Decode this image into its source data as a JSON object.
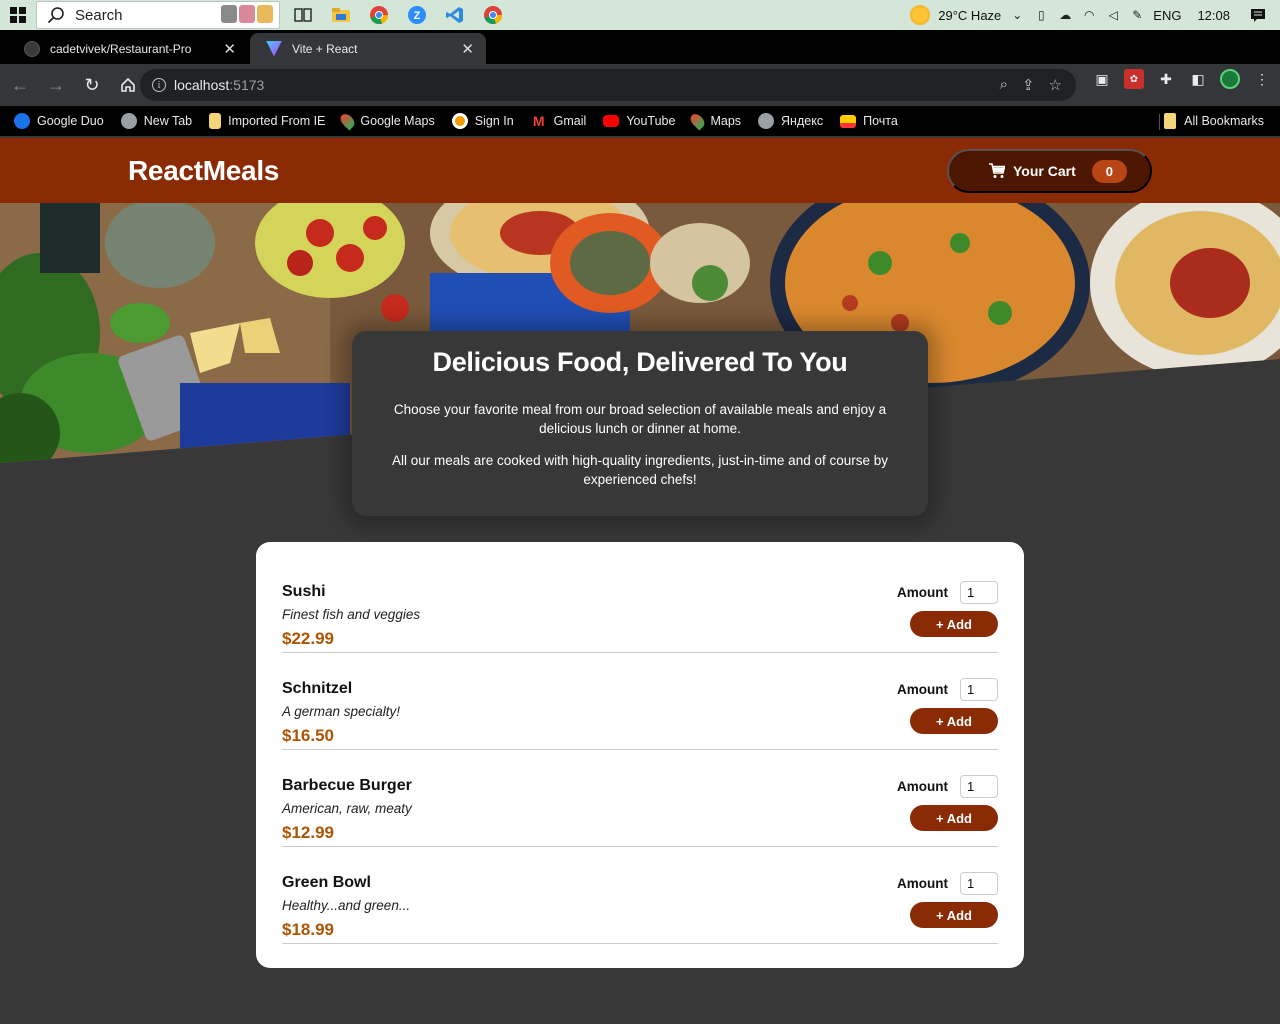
{
  "taskbar": {
    "search_placeholder": "Search",
    "weather": "29°C  Haze",
    "language": "ENG",
    "time": "12:08"
  },
  "browser": {
    "tabs": [
      {
        "title": "cadetvivek/Restaurant-Pro",
        "active": false
      },
      {
        "title": "Vite + React",
        "active": true
      }
    ],
    "url_host": "localhost",
    "url_port": ":5173",
    "bookmarks": [
      {
        "label": "Google Duo",
        "icon": "duo-icon",
        "color": "#1a73e8"
      },
      {
        "label": "New Tab",
        "icon": "globe-icon",
        "color": "#9aa0a6"
      },
      {
        "label": "Imported From IE",
        "icon": "folder-icon",
        "color": "#f6d57a"
      },
      {
        "label": "Google Maps",
        "icon": "maps-pin-icon",
        "color": "#34a853"
      },
      {
        "label": "Sign In",
        "icon": "sign-in-icon",
        "color": "#f29900"
      },
      {
        "label": "Gmail",
        "icon": "gmail-icon",
        "color": "#ea4335"
      },
      {
        "label": "YouTube",
        "icon": "youtube-icon",
        "color": "#ff0000"
      },
      {
        "label": "Maps",
        "icon": "maps-pin-icon",
        "color": "#34a853"
      },
      {
        "label": "Яндекс",
        "icon": "globe-icon",
        "color": "#9aa0a6"
      },
      {
        "label": "Почта",
        "icon": "mail-icon",
        "color": "#ffcc00"
      }
    ],
    "all_bookmarks": "All Bookmarks"
  },
  "app": {
    "logo": "ReactMeals",
    "cart_label": "Your Cart",
    "cart_count": "0",
    "brand_color": "#8a2b06",
    "summary": {
      "title": "Delicious Food, Delivered To You",
      "p1": "Choose your favorite meal from our broad selection of available meals and enjoy a delicious lunch or dinner at home.",
      "p2": "All our meals are cooked with high-quality ingredients, just-in-time and of course by experienced chefs!"
    },
    "amount_label": "Amount",
    "add_label": "+ Add",
    "meals": [
      {
        "name": "Sushi",
        "description": "Finest fish and veggies",
        "price": "$22.99",
        "amount": "1"
      },
      {
        "name": "Schnitzel",
        "description": "A german specialty!",
        "price": "$16.50",
        "amount": "1"
      },
      {
        "name": "Barbecue Burger",
        "description": "American, raw, meaty",
        "price": "$12.99",
        "amount": "1"
      },
      {
        "name": "Green Bowl",
        "description": "Healthy...and green...",
        "price": "$18.99",
        "amount": "1"
      }
    ]
  }
}
